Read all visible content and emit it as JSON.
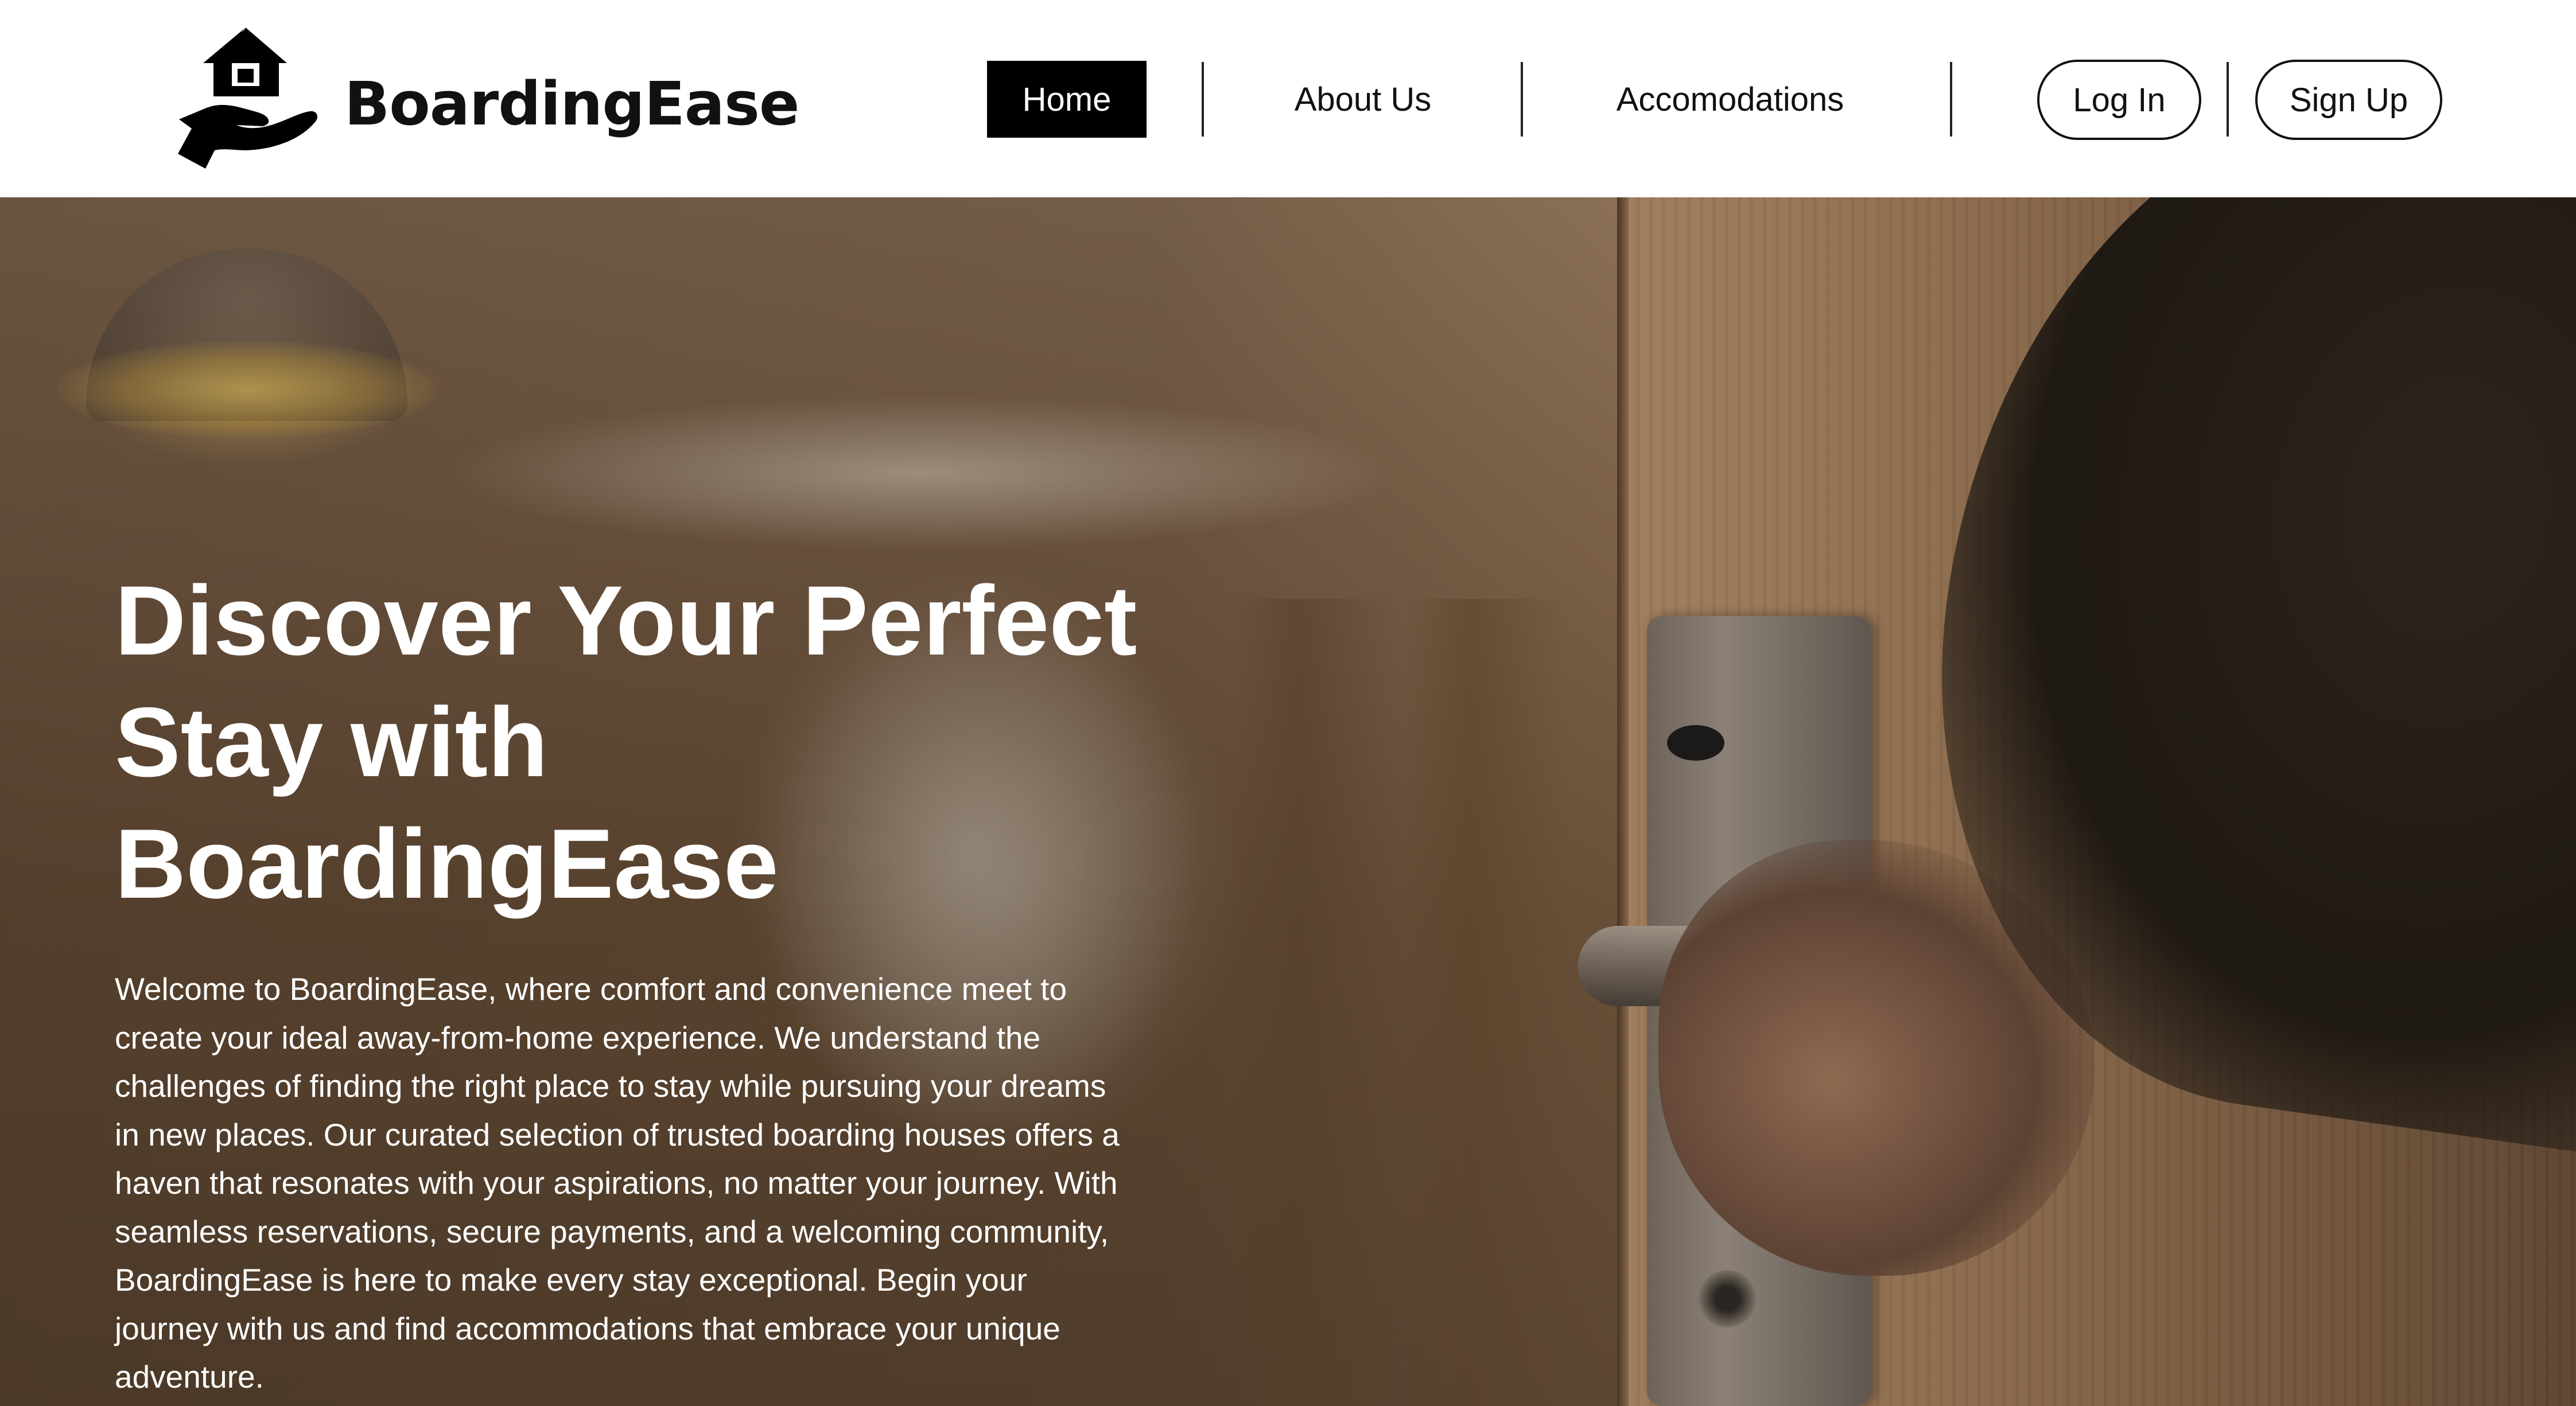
{
  "header": {
    "logo": {
      "name": "BoardingEase",
      "icon": "house-in-hand-icon"
    },
    "nav": [
      {
        "label": "Home",
        "active": true
      },
      {
        "label": "About Us",
        "active": false
      },
      {
        "label": "Accomodations",
        "active": false
      }
    ],
    "auth": {
      "login_label": "Log In",
      "signup_label": "Sign Up"
    }
  },
  "hero": {
    "title": "Discover Your Perfect Stay with BoardingEase",
    "description": "Welcome to BoardingEase, where comfort and convenience meet to create your ideal away-from-home experience. We understand the challenges of finding the right place to stay while pursuing your dreams in new places. Our curated selection of trusted boarding houses offers a haven that resonates with your aspirations, no matter your journey. With seamless reservations, secure payments, and a welcoming community, BoardingEase is here to make every stay exceptional. Begin your journey with us and find accommodations that embrace your unique adventure.",
    "background": "blurred hotel room with a hand opening a wooden door"
  },
  "colors": {
    "header_bg": "#ffffff",
    "active_nav_bg": "#000000",
    "active_nav_text": "#ffffff",
    "text_dark": "#111111",
    "hero_text": "#ffffff"
  }
}
